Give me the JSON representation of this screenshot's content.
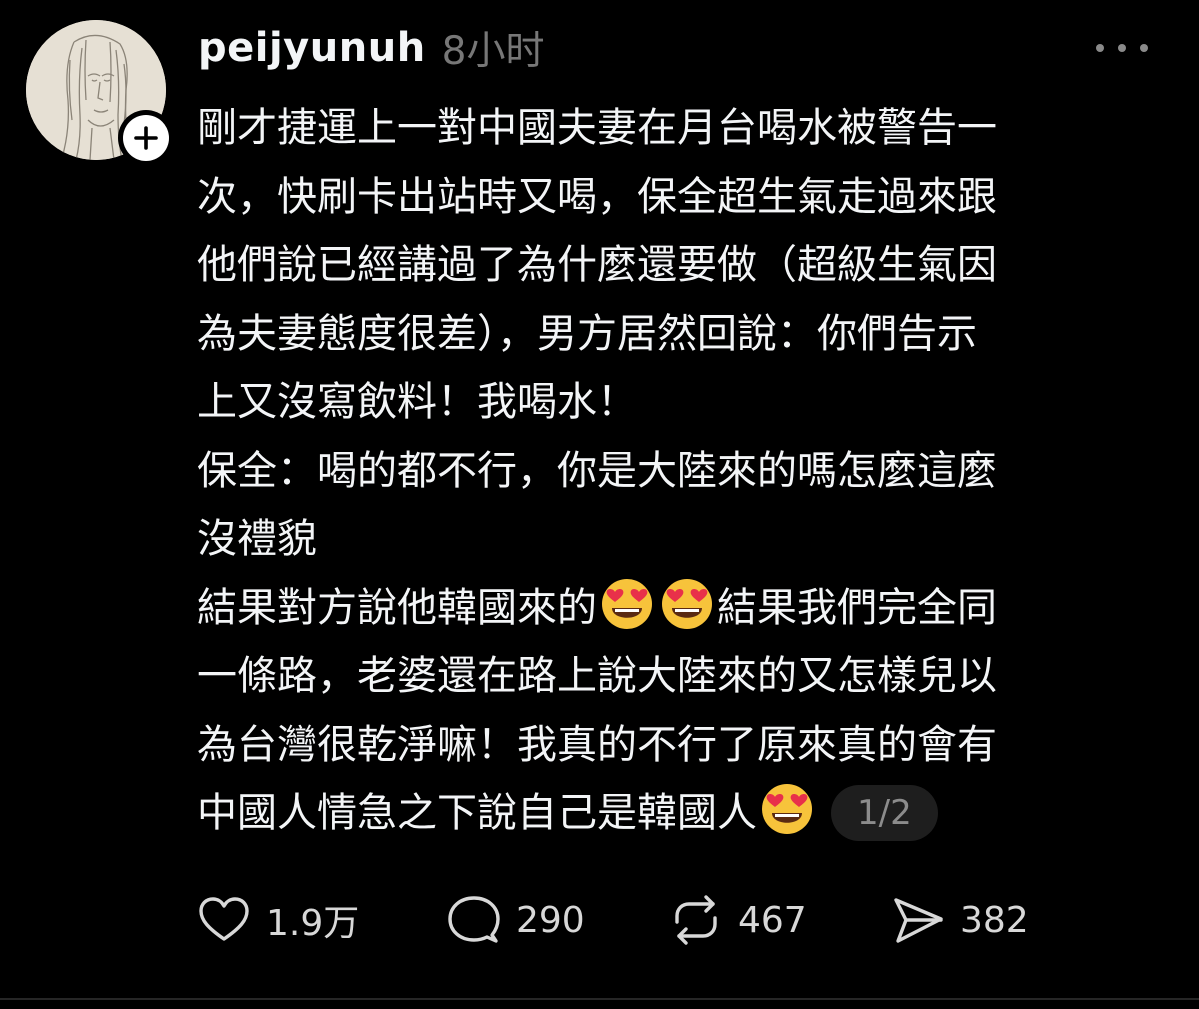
{
  "post": {
    "username": "peijyunuh",
    "timestamp": "8小时",
    "lines": [
      "剛才捷運上一對中國夫妻在月台喝水被警告一",
      "次，快刷卡出站時又喝，保全超生氣走過來跟",
      "他們說已經講過了為什麼還要做（超級生氣因",
      "為夫妻態度很差），男方居然回說：你們告示",
      "上又沒寫飲料！我喝水！",
      "保全：喝的都不行，你是大陸來的嗎怎麼這麼",
      "沒禮貌",
      "結果對方說他韓國來的",
      "結果我們完全同",
      "一條路，老婆還在路上說大陸來的又怎樣兒以",
      "為台灣很乾淨嘛！我真的不行了原來真的會有",
      "中國人情急之下說自己是韓國人"
    ],
    "emoji_name": "smiling-face-with-heart-eyes-icon",
    "page_indicator": "1/2"
  },
  "actions": {
    "likes": "1.9万",
    "replies": "290",
    "reposts": "467",
    "shares": "382"
  },
  "colors": {
    "background": "#000000",
    "text": "#f3f5f7",
    "muted": "#777777",
    "counts": "#d8d8d8",
    "badge_bg": "#1e1e1e"
  }
}
